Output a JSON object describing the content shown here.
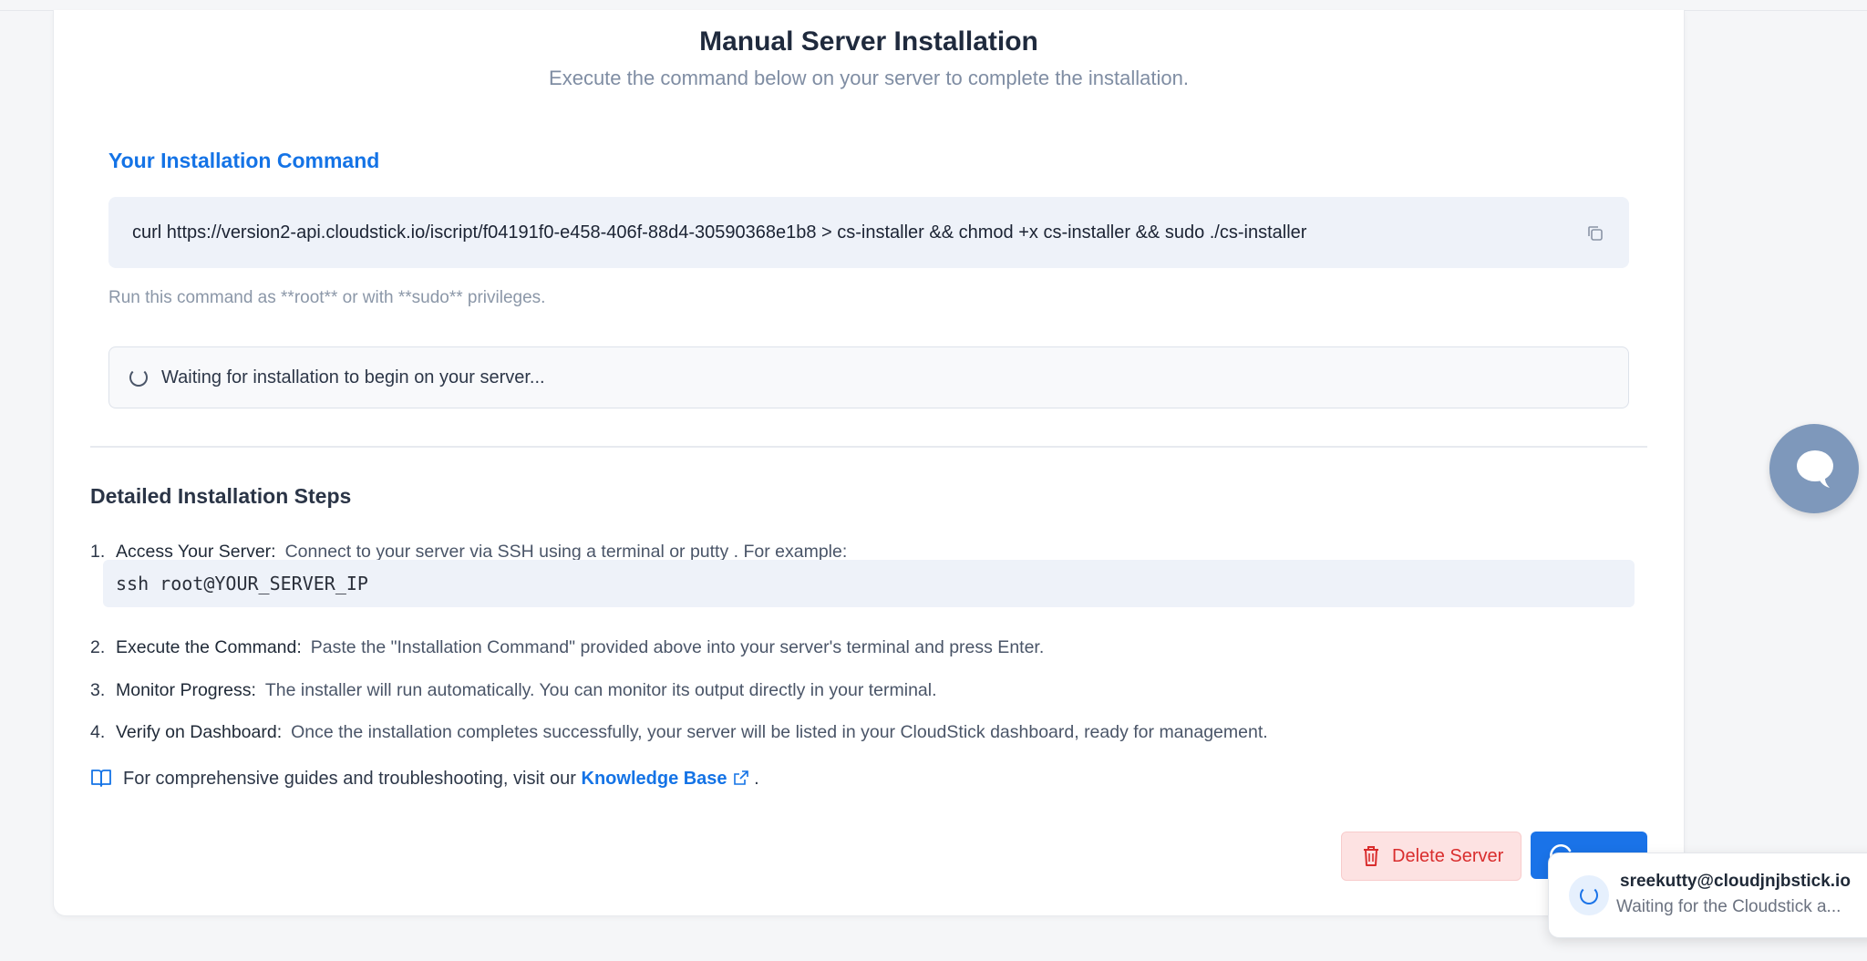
{
  "header": {
    "title": "Manual Server Installation",
    "subtitle": "Execute the command below on your server to complete the installation."
  },
  "command": {
    "heading": "Your Installation Command",
    "text": "curl https://version2-api.cloudstick.io/iscript/f04191f0-e458-406f-88d4-30590368e1b8 > cs-installer && chmod +x cs-installer && sudo ./cs-installer",
    "copy_icon": "copy-icon",
    "note": "Run this command as **root** or with **sudo** privileges."
  },
  "status": {
    "waiting_text": "Waiting for installation to begin on your server..."
  },
  "steps": {
    "heading": "Detailed Installation Steps",
    "items": [
      {
        "num": "1.",
        "label": "Access Your Server:",
        "text": "Connect to your server via SSH using a terminal or putty . For example:"
      },
      {
        "num": "2.",
        "label": "Execute the Command:",
        "text": "Paste the \"Installation Command\" provided above into your server's terminal and press Enter."
      },
      {
        "num": "3.",
        "label": "Monitor Progress:",
        "text": "The installer will run automatically. You can monitor its output directly in your terminal."
      },
      {
        "num": "4.",
        "label": "Verify on Dashboard:",
        "text": "Once the installation completes successfully, your server will be listed in your CloudStick dashboard, ready for management."
      }
    ],
    "code_example": "ssh root@YOUR_SERVER_IP"
  },
  "knowledge": {
    "prefix": "For comprehensive guides and troubleshooting, visit our",
    "link": "Knowledge Base",
    "suffix": "."
  },
  "actions": {
    "delete_label": "Delete Server"
  },
  "toast": {
    "title": "sreekutty@cloudjnjbstick.io",
    "message": "Waiting for the Cloudstick a..."
  },
  "colors": {
    "accent": "#1473e6",
    "danger": "#d92d2d",
    "danger_bg": "#fde2e2",
    "chat_bubble": "#7e98bb"
  }
}
